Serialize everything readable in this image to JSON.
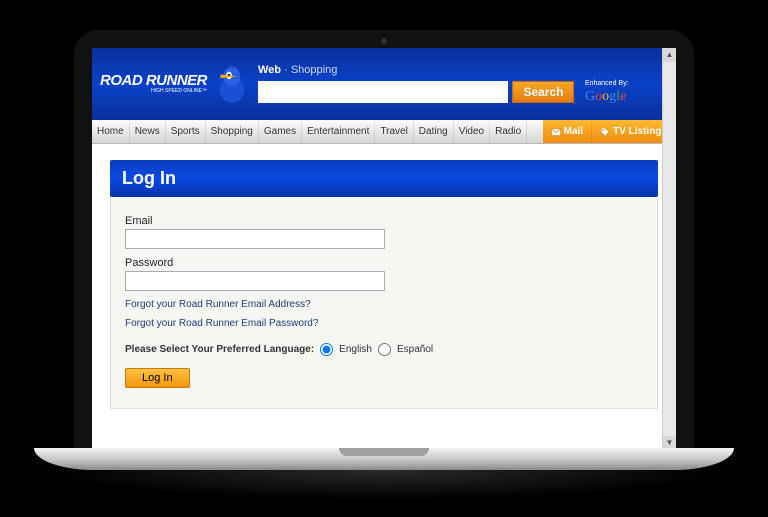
{
  "header": {
    "logo_main": "ROAD RUNNER",
    "logo_sub": "HIGH SPEED ONLINE™",
    "search_tabs": {
      "web": "Web",
      "sep": "·",
      "shopping": "Shopping"
    },
    "search_button": "Search",
    "enhanced_label": "Enhanced By:",
    "google": "Google"
  },
  "nav": {
    "items": [
      "Home",
      "News",
      "Sports",
      "Shopping",
      "Games",
      "Entertainment",
      "Travel",
      "Dating",
      "Video",
      "Radio"
    ],
    "mail": "Mail",
    "tv": "TV Listings"
  },
  "login": {
    "title": "Log In",
    "email_label": "Email",
    "password_label": "Password",
    "forgot_email": "Forgot your Road Runner Email Address?",
    "forgot_password": "Forgot your Road Runner Email Password?",
    "lang_prompt": "Please Select Your Preferred Language:",
    "lang_english": "English",
    "lang_spanish": "Español",
    "button": "Log In"
  }
}
